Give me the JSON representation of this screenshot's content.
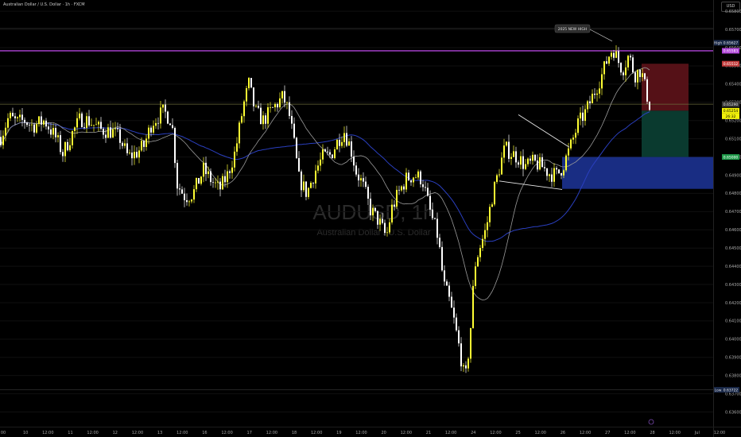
{
  "header": {
    "symbol_line": "Australian Dollar / U.S. Dollar · 1h · FXCM",
    "currency": "USD"
  },
  "watermark": {
    "ticker": "AUDUSD, 1h",
    "name": "Australian Dollar / U.S. Dollar"
  },
  "annotations": {
    "new_high_label": "2025 NEW HIGH"
  },
  "price_tags": {
    "high_label": "High",
    "high_value": "0.65627",
    "low_label": "Low",
    "low_value": "0.63722",
    "purple_level": "0.65583",
    "stop_value": "0.65512",
    "grey_value": "0.65290",
    "current_value": "0.65254",
    "countdown": "26:32",
    "target_value": "0.65000"
  },
  "colors": {
    "bull": "#ffff33",
    "bear": "#ffffff",
    "ma_fast": "#9a9a9a",
    "ma_slow": "#2a3fbf",
    "resistance": "#b044d8",
    "stop_zone": "#5a1218",
    "target_zone": "#0b3d32",
    "demand_zone": "#1a2f8a"
  },
  "chart_data": {
    "type": "candlestick",
    "timeframe": "1h",
    "ylim": [
      0.6355,
      0.6584
    ],
    "y_ticks": [
      "0.65800",
      "0.65700",
      "0.65600",
      "0.65500",
      "0.65400",
      "0.65300",
      "0.65200",
      "0.65100",
      "0.65000",
      "0.64900",
      "0.64800",
      "0.64700",
      "0.64600",
      "0.64500",
      "0.64400",
      "0.64300",
      "0.64200",
      "0.64100",
      "0.64000",
      "0.63900",
      "0.63800",
      "0.63700",
      "0.63600"
    ],
    "x_ticks": [
      "00",
      "10",
      "12:00",
      "11",
      "12:00",
      "12",
      "12:00",
      "13",
      "12:00",
      "16",
      "12:00",
      "17",
      "12:00",
      "18",
      "12:00",
      "19",
      "12:00",
      "20",
      "12:00",
      "21",
      "12:00",
      "24",
      "12:00",
      "25",
      "12:00",
      "26",
      "12:00",
      "27",
      "12:00",
      "28",
      "12:00",
      "Jul",
      "12:00"
    ],
    "close_anchors": [
      [
        0,
        0.6511
      ],
      [
        10,
        0.6522
      ],
      [
        20,
        0.6519
      ],
      [
        30,
        0.652
      ],
      [
        40,
        0.6517
      ],
      [
        55,
        0.652
      ],
      [
        70,
        0.651
      ],
      [
        78,
        0.6502
      ],
      [
        90,
        0.6513
      ],
      [
        100,
        0.6521
      ],
      [
        110,
        0.652
      ],
      [
        125,
        0.6515
      ],
      [
        140,
        0.6514
      ],
      [
        150,
        0.651
      ],
      [
        160,
        0.65
      ],
      [
        170,
        0.6502
      ],
      [
        180,
        0.6506
      ],
      [
        190,
        0.6519
      ],
      [
        205,
        0.6525
      ],
      [
        215,
        0.652
      ],
      [
        222,
        0.6485
      ],
      [
        232,
        0.6478
      ],
      [
        242,
        0.648
      ],
      [
        255,
        0.6493
      ],
      [
        265,
        0.6487
      ],
      [
        275,
        0.6482
      ],
      [
        285,
        0.649
      ],
      [
        295,
        0.6503
      ],
      [
        305,
        0.6528
      ],
      [
        312,
        0.654
      ],
      [
        320,
        0.6525
      ],
      [
        330,
        0.652
      ],
      [
        345,
        0.6528
      ],
      [
        355,
        0.6533
      ],
      [
        362,
        0.6525
      ],
      [
        368,
        0.651
      ],
      [
        375,
        0.6488
      ],
      [
        385,
        0.648
      ],
      [
        395,
        0.6492
      ],
      [
        405,
        0.65
      ],
      [
        415,
        0.6501
      ],
      [
        425,
        0.651
      ],
      [
        432,
        0.6514
      ],
      [
        440,
        0.6505
      ],
      [
        447,
        0.6492
      ],
      [
        455,
        0.6485
      ],
      [
        465,
        0.6471
      ],
      [
        475,
        0.6465
      ],
      [
        485,
        0.6456
      ],
      [
        492,
        0.6472
      ],
      [
        500,
        0.648
      ],
      [
        510,
        0.6488
      ],
      [
        520,
        0.649
      ],
      [
        530,
        0.6488
      ],
      [
        540,
        0.647
      ],
      [
        550,
        0.6456
      ],
      [
        557,
        0.643
      ],
      [
        563,
        0.6423
      ],
      [
        570,
        0.641
      ],
      [
        578,
        0.6392
      ],
      [
        584,
        0.6376
      ],
      [
        590,
        0.64
      ],
      [
        596,
        0.644
      ],
      [
        602,
        0.645
      ],
      [
        610,
        0.646
      ],
      [
        618,
        0.6478
      ],
      [
        626,
        0.6492
      ],
      [
        634,
        0.6505
      ],
      [
        642,
        0.6502
      ],
      [
        650,
        0.65
      ],
      [
        660,
        0.6495
      ],
      [
        670,
        0.6497
      ],
      [
        680,
        0.6495
      ],
      [
        690,
        0.6491
      ],
      [
        700,
        0.649
      ],
      [
        707,
        0.6495
      ],
      [
        716,
        0.6505
      ],
      [
        726,
        0.6518
      ],
      [
        736,
        0.6525
      ],
      [
        746,
        0.6535
      ],
      [
        756,
        0.6545
      ],
      [
        764,
        0.6555
      ],
      [
        770,
        0.656
      ],
      [
        776,
        0.6553
      ],
      [
        782,
        0.6548
      ],
      [
        790,
        0.6556
      ],
      [
        797,
        0.6545
      ],
      [
        805,
        0.6548
      ],
      [
        812,
        0.6535
      ],
      [
        817,
        0.6527
      ]
    ],
    "moving_averages": [
      {
        "name": "fast",
        "length": 20
      },
      {
        "name": "slow",
        "length": 50
      }
    ],
    "levels": [
      {
        "price": 0.65583,
        "style": "solid",
        "color": "resistance"
      },
      {
        "price": 0.6529,
        "style": "solid",
        "color": "grey"
      }
    ],
    "zones": [
      {
        "kind": "stop",
        "price_top": 0.65512,
        "price_bottom": 0.65254,
        "x_from": 807,
        "x_to": 866
      },
      {
        "kind": "target",
        "price_top": 0.65254,
        "price_bottom": 0.65,
        "x_from": 807,
        "x_to": 866
      },
      {
        "kind": "demand",
        "price_top": 0.65,
        "price_bottom": 0.64825,
        "x_from": 707,
        "x_to": 897
      }
    ],
    "triangle": {
      "upper": [
        [
          652,
          0.65232
        ],
        [
          716,
          0.65054
        ]
      ],
      "lower": [
        [
          628,
          0.64868
        ],
        [
          707,
          0.64822
        ]
      ]
    },
    "new_high_point": [
      770,
      0.65627
    ],
    "low_point": [
      584,
      0.63722
    ]
  }
}
